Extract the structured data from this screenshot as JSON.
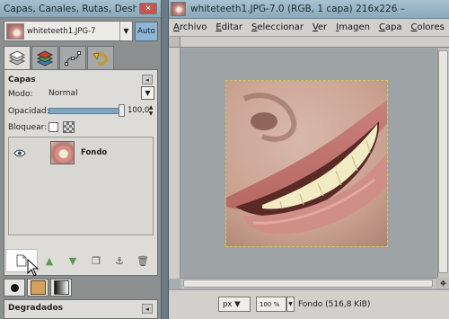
{
  "dock": {
    "title": "Capas, Canales, Rutas, Deshacer ...",
    "image_name": "whiteteeth1.JPG-7",
    "auto_label": "Auto",
    "tabs": [
      "layers-icon",
      "channels-icon",
      "paths-icon",
      "undo-icon"
    ],
    "panel": {
      "heading": "Capas",
      "mode_label": "Modo:",
      "mode_value": "Normal",
      "opacity_label": "Opacidad:",
      "opacity_value": "100,0",
      "opacity_percent": 100,
      "lock_label": "Bloquear:",
      "layers": [
        {
          "name": "Fondo",
          "visible": true
        }
      ]
    },
    "gradients_label": "Degradados"
  },
  "imagewin": {
    "title": "whiteteeth1.JPG-7.0 (RGB, 1 capa) 216x226 –",
    "menu": [
      "Archivo",
      "Editar",
      "Seleccionar",
      "Ver",
      "Imagen",
      "Capa",
      "Colores"
    ],
    "status": {
      "unit": "px",
      "zoom": "100 %",
      "info": "Fondo (516,8 KiB)"
    }
  },
  "colors": {
    "titlebar": "#8aa7b8",
    "selection": "#d8c54c",
    "auto_button": "#8fb6d2"
  }
}
